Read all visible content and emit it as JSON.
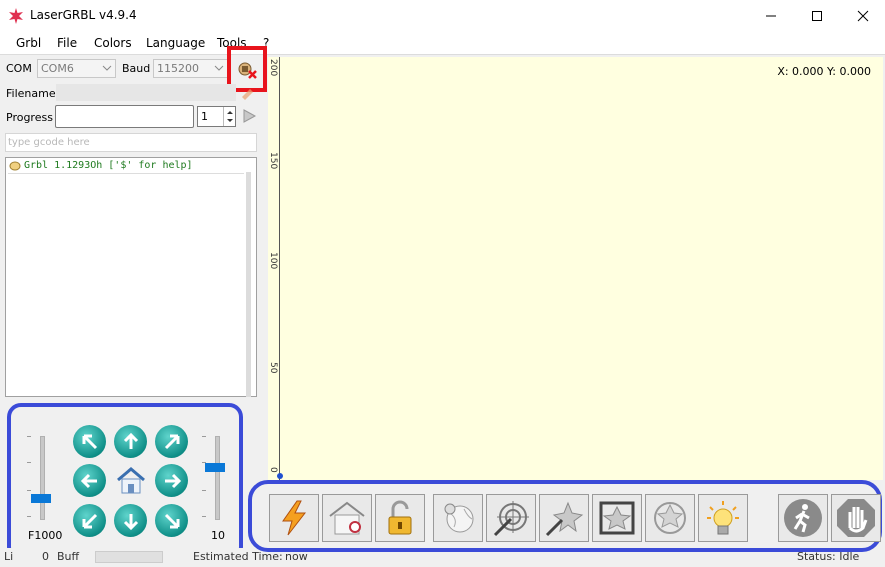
{
  "window": {
    "title": "LaserGRBL v4.9.4"
  },
  "menu": [
    "Grbl",
    "File",
    "Colors",
    "Language",
    "Tools",
    "?"
  ],
  "connection": {
    "com_label": "COM",
    "com_value": "COM6",
    "baud_label": "Baud",
    "baud_value": "115200"
  },
  "file": {
    "filename_label": "Filename",
    "progress_label": "Progress",
    "passes_value": "1"
  },
  "gcode": {
    "placeholder": "type gcode here"
  },
  "console": {
    "line": "Grbl 1.1293Oh ['$' for help]"
  },
  "jog": {
    "feed_label": "F1000",
    "step_label": "10"
  },
  "status_bar": {
    "lines": "Li",
    "lines_val": "0",
    "buffer": "Buff",
    "estimated": "Estimated Time:",
    "estimated_val": "now",
    "status": "Status: Idle"
  },
  "preview": {
    "coords": "X: 0.000 Y: 0.000",
    "ruler": [
      "200",
      "150",
      "100",
      "50",
      "0"
    ]
  },
  "toolbar_icons": [
    "laser-flash-icon",
    "home-icon",
    "unlock-icon",
    "globe-marker-icon",
    "target-icon",
    "laser-star-icon",
    "frame-icon",
    "crosshair-icon",
    "bulb-icon",
    "walk-icon",
    "stop-hand-icon"
  ],
  "colors": {
    "highlight_blue": "#3b4bd8",
    "highlight_red": "#e8141c",
    "preview_bg": "#ffffe0",
    "jog_teal": "#0f8f88",
    "slider": "#0a78d7"
  }
}
